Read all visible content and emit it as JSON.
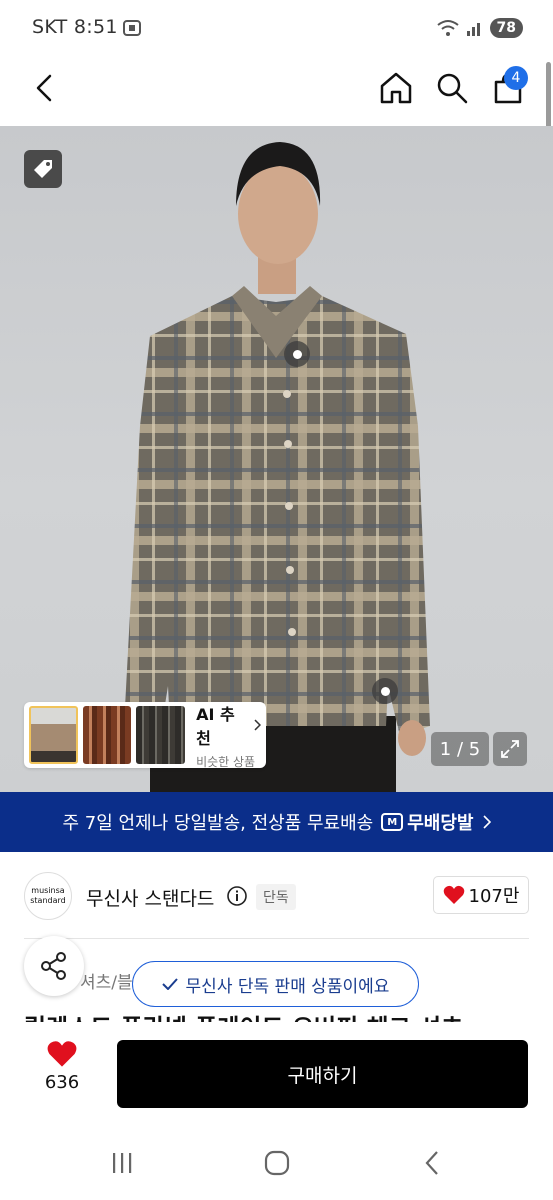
{
  "status_bar": {
    "time": "SKT 8:51",
    "battery": "78"
  },
  "header": {
    "cart_count": "4"
  },
  "hero": {
    "page_indicator": "1 / 5",
    "ai_card": {
      "title": "AI 추천",
      "subtitle": "비슷한 상품"
    }
  },
  "banner": {
    "text": "주 7일 언제나 당일발송, 전상품 무료배송",
    "logo_text": "무배당발",
    "logo_mark": "M"
  },
  "brand": {
    "logo_line1": "musinsa",
    "logo_line2": "standard",
    "name": "무신사 스탠다드",
    "badge": "단독",
    "likes": "107만"
  },
  "breadcrumb": "셔츠/블",
  "product_title": "릴렉스드 플란넬 플레이드 오버핏 체크 셔츠",
  "toast": "무신사 단독 판매 상품이에요",
  "purchase": {
    "wish_count": "636",
    "buy_label": "구매하기"
  },
  "colors": {
    "banner": "#0b2e8a",
    "heart": "#e0101e",
    "accent": "#1f6fe8"
  }
}
